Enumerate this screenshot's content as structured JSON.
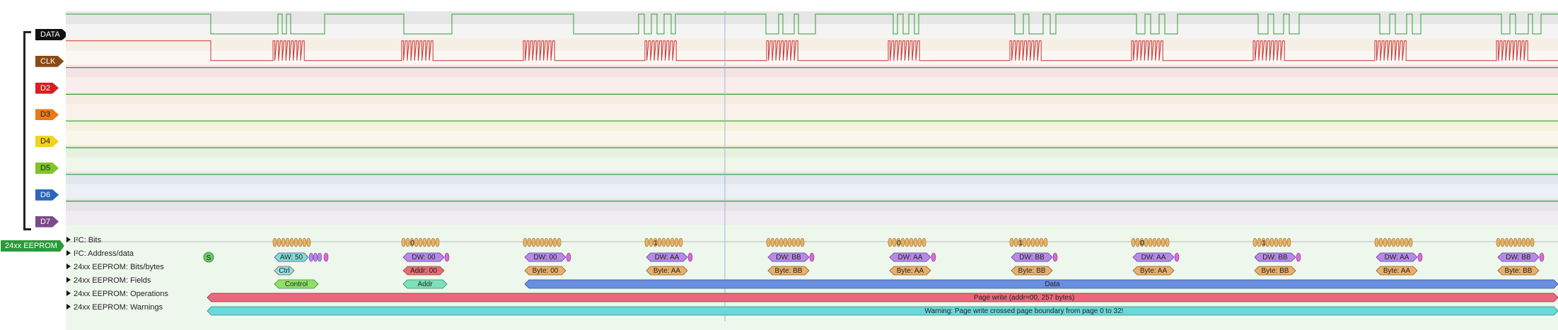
{
  "channels": [
    {
      "name": "DATA",
      "color": "#111111",
      "text": "#ffffff",
      "bg": "#e6e6e6",
      "bg2": "#f4f4f4",
      "line": "#2f9e2f"
    },
    {
      "name": "CLK",
      "color": "#8a4a14",
      "text": "#ffffff",
      "bg": "#f6efe6",
      "bg2": "#fbf8f3",
      "line": "#2f9e2f"
    },
    {
      "name": "D2",
      "color": "#d42020",
      "text": "#ffffff",
      "bg": "#f5e3e3",
      "bg2": "#f9eded",
      "line": "#2f9e2f"
    },
    {
      "name": "D3",
      "color": "#e87a1a",
      "text": "#222222",
      "bg": "#f6ebe1",
      "bg2": "#f9f1ea",
      "line": "#2f9e2f"
    },
    {
      "name": "D4",
      "color": "#f2d21a",
      "text": "#222222",
      "bg": "#f5f2e0",
      "bg2": "#f9f7ec",
      "line": "#2f9e2f"
    },
    {
      "name": "D5",
      "color": "#7cc62a",
      "text": "#222222",
      "bg": "#e8f1df",
      "bg2": "#eff6ea",
      "line": "#2f9e2f"
    },
    {
      "name": "D6",
      "color": "#2b66b8",
      "text": "#ffffff",
      "bg": "#e2e6ee",
      "bg2": "#eceff4",
      "line": "#2f9e2f"
    },
    {
      "name": "D7",
      "color": "#7a4a8a",
      "text": "#ffffff",
      "bg": "#e8e2ea",
      "bg2": "#f1ecf2",
      "line": "#2f9e2f"
    }
  ],
  "group_label": "24xx EEPROM",
  "decoder_rows": [
    {
      "label": "I²C: Bits"
    },
    {
      "label": "I²C: Address/data"
    },
    {
      "label": "24xx EEPROM: Bits/bytes"
    },
    {
      "label": "24xx EEPROM: Fields"
    },
    {
      "label": "24xx EEPROM: Operations"
    },
    {
      "label": "24xx EEPROM: Warnings"
    }
  ],
  "start_marker": "S",
  "bits_digits": [
    "0",
    "1",
    "0",
    "1",
    "0",
    "0",
    "1"
  ],
  "address_data": [
    "AW: 50",
    "DW: 00",
    "DW: 00",
    "DW: AA",
    "DW: BB",
    "DW: AA",
    "DW: BB",
    "DW: AA",
    "DW: BB",
    "DW: AA",
    "DW: BB"
  ],
  "bits_bytes": [
    "Ctrl",
    "Addr: 00",
    "Byte: 00",
    "Byte: AA",
    "Byte: BB",
    "Byte: AA",
    "Byte: BB",
    "Byte: AA",
    "Byte: BB",
    "Byte: AA",
    "Byte: BB"
  ],
  "fields": [
    "Control",
    "Addr",
    "Data"
  ],
  "operation": "Page write (addr=00, 257 bytes)",
  "warning": "Warning: Page write crossed page boundary from page 0 to 32!",
  "colors": {
    "bits": "#e8b46a",
    "bits_stroke": "#9a6a20",
    "address": "#b68ae6",
    "address_first": "#7de0d2",
    "address_stroke": "#6a3a9a",
    "ack": "#d86cd8",
    "byte": "#e9b06b",
    "byte_addr": "#e56a78",
    "byte_ctrl": "#8fe0e8",
    "field_control": "#8fe06a",
    "field_addr": "#7de0b8",
    "field_data": "#6b8fe0",
    "operation": "#e86a7c",
    "warning": "#6ad8d8",
    "signal_high": "#2f9e2f",
    "signal_low": "#c83232",
    "cursor": "#9bb7d4"
  }
}
